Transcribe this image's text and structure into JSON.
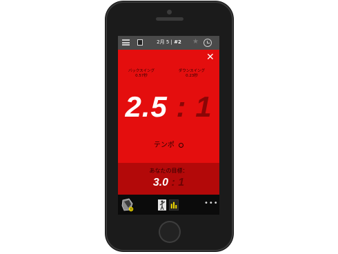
{
  "header": {
    "date": "2月 5 |",
    "shot": "#2"
  },
  "metrics": {
    "backswing_label": "バックスイング",
    "backswing_value": "0.57秒",
    "downswing_label": "ダウンスイング",
    "downswing_value": "0.23秒"
  },
  "ratio": {
    "value": "2.5",
    "separator": ":",
    "denominator": "1"
  },
  "tempo": {
    "label": "テンポ"
  },
  "goal": {
    "label": "あなたの目標：",
    "value": "3.0",
    "rest": ": 1"
  },
  "colors": {
    "accent_red": "#e40e0e",
    "goal_red": "#b30909",
    "highlight_yellow": "#f0d800"
  },
  "icons": [
    "menu-icon",
    "club-icon",
    "star-icon",
    "clock-icon",
    "close-icon",
    "info-icon",
    "club-head-icon",
    "golfer-icon",
    "bar-chart-icon",
    "more-icon"
  ]
}
